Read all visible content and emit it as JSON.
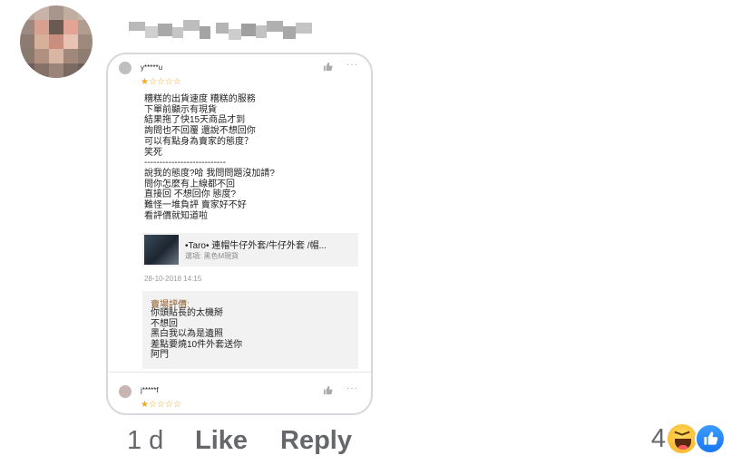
{
  "comment": {
    "author_redacted": true,
    "time": "1 d",
    "actions": {
      "like": "Like",
      "reply": "Reply"
    },
    "reaction_count": "4",
    "reactions": [
      "haha-icon",
      "like-icon"
    ]
  },
  "screenshot": {
    "review1": {
      "user": "y*****u",
      "stars": "★☆☆☆☆",
      "text": "糟糕的出貨速度 糟糕的服務\n下單前顯示有現貨\n結果拖了快15天商品才到\n詢問也不回覆 還說不想回你\n可以有點身為賣家的態度？\n笑死\n---------------------------\n說我的態度?哈 我問問題沒加請?\n問你怎麼有上線都不回\n直接回 不想回你 態度?\n難怪一堆負評 賣家好不好\n看評價就知道啦",
      "product_title": "•Taro•  連帽牛仔外套/牛仔外套 /帽...",
      "product_variant": "選項: 黑色M現貨",
      "date": "28-10-2018 14:15",
      "seller_label": "賣場評價:",
      "seller_reply": "你頭貼長的太機掰\n不想回\n黑白我以為是遺照\n差點要燒10件外套送你\n阿門"
    },
    "review2": {
      "user": "j*****f",
      "stars": "★☆☆☆☆"
    }
  },
  "colors": {
    "secondary_text": "#65676b",
    "star": "#f5a623",
    "seller_label": "#8a5a2b",
    "facebook_blue": "#1877f2"
  }
}
